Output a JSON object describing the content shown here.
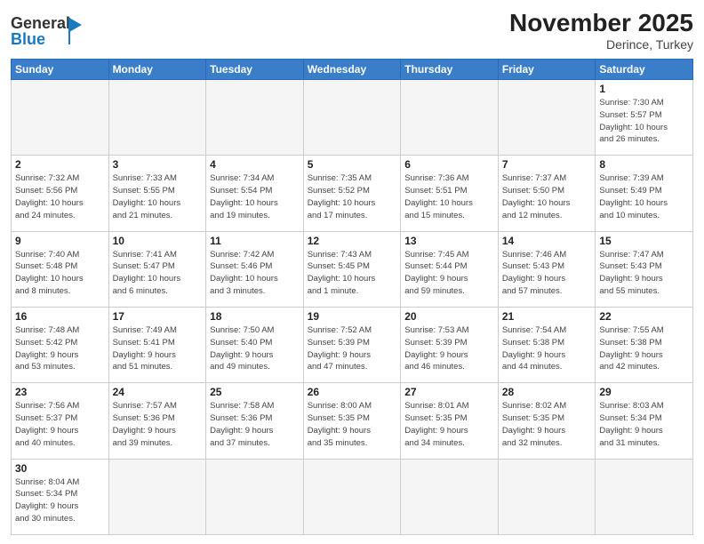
{
  "header": {
    "title": "November 2025",
    "subtitle": "Derince, Turkey",
    "logo_general": "General",
    "logo_blue": "Blue"
  },
  "weekdays": [
    "Sunday",
    "Monday",
    "Tuesday",
    "Wednesday",
    "Thursday",
    "Friday",
    "Saturday"
  ],
  "weeks": [
    [
      {
        "day": "",
        "info": ""
      },
      {
        "day": "",
        "info": ""
      },
      {
        "day": "",
        "info": ""
      },
      {
        "day": "",
        "info": ""
      },
      {
        "day": "",
        "info": ""
      },
      {
        "day": "",
        "info": ""
      },
      {
        "day": "1",
        "info": "Sunrise: 7:30 AM\nSunset: 5:57 PM\nDaylight: 10 hours\nand 26 minutes."
      }
    ],
    [
      {
        "day": "2",
        "info": "Sunrise: 7:32 AM\nSunset: 5:56 PM\nDaylight: 10 hours\nand 24 minutes."
      },
      {
        "day": "3",
        "info": "Sunrise: 7:33 AM\nSunset: 5:55 PM\nDaylight: 10 hours\nand 21 minutes."
      },
      {
        "day": "4",
        "info": "Sunrise: 7:34 AM\nSunset: 5:54 PM\nDaylight: 10 hours\nand 19 minutes."
      },
      {
        "day": "5",
        "info": "Sunrise: 7:35 AM\nSunset: 5:52 PM\nDaylight: 10 hours\nand 17 minutes."
      },
      {
        "day": "6",
        "info": "Sunrise: 7:36 AM\nSunset: 5:51 PM\nDaylight: 10 hours\nand 15 minutes."
      },
      {
        "day": "7",
        "info": "Sunrise: 7:37 AM\nSunset: 5:50 PM\nDaylight: 10 hours\nand 12 minutes."
      },
      {
        "day": "8",
        "info": "Sunrise: 7:39 AM\nSunset: 5:49 PM\nDaylight: 10 hours\nand 10 minutes."
      }
    ],
    [
      {
        "day": "9",
        "info": "Sunrise: 7:40 AM\nSunset: 5:48 PM\nDaylight: 10 hours\nand 8 minutes."
      },
      {
        "day": "10",
        "info": "Sunrise: 7:41 AM\nSunset: 5:47 PM\nDaylight: 10 hours\nand 6 minutes."
      },
      {
        "day": "11",
        "info": "Sunrise: 7:42 AM\nSunset: 5:46 PM\nDaylight: 10 hours\nand 3 minutes."
      },
      {
        "day": "12",
        "info": "Sunrise: 7:43 AM\nSunset: 5:45 PM\nDaylight: 10 hours\nand 1 minute."
      },
      {
        "day": "13",
        "info": "Sunrise: 7:45 AM\nSunset: 5:44 PM\nDaylight: 9 hours\nand 59 minutes."
      },
      {
        "day": "14",
        "info": "Sunrise: 7:46 AM\nSunset: 5:43 PM\nDaylight: 9 hours\nand 57 minutes."
      },
      {
        "day": "15",
        "info": "Sunrise: 7:47 AM\nSunset: 5:43 PM\nDaylight: 9 hours\nand 55 minutes."
      }
    ],
    [
      {
        "day": "16",
        "info": "Sunrise: 7:48 AM\nSunset: 5:42 PM\nDaylight: 9 hours\nand 53 minutes."
      },
      {
        "day": "17",
        "info": "Sunrise: 7:49 AM\nSunset: 5:41 PM\nDaylight: 9 hours\nand 51 minutes."
      },
      {
        "day": "18",
        "info": "Sunrise: 7:50 AM\nSunset: 5:40 PM\nDaylight: 9 hours\nand 49 minutes."
      },
      {
        "day": "19",
        "info": "Sunrise: 7:52 AM\nSunset: 5:39 PM\nDaylight: 9 hours\nand 47 minutes."
      },
      {
        "day": "20",
        "info": "Sunrise: 7:53 AM\nSunset: 5:39 PM\nDaylight: 9 hours\nand 46 minutes."
      },
      {
        "day": "21",
        "info": "Sunrise: 7:54 AM\nSunset: 5:38 PM\nDaylight: 9 hours\nand 44 minutes."
      },
      {
        "day": "22",
        "info": "Sunrise: 7:55 AM\nSunset: 5:38 PM\nDaylight: 9 hours\nand 42 minutes."
      }
    ],
    [
      {
        "day": "23",
        "info": "Sunrise: 7:56 AM\nSunset: 5:37 PM\nDaylight: 9 hours\nand 40 minutes."
      },
      {
        "day": "24",
        "info": "Sunrise: 7:57 AM\nSunset: 5:36 PM\nDaylight: 9 hours\nand 39 minutes."
      },
      {
        "day": "25",
        "info": "Sunrise: 7:58 AM\nSunset: 5:36 PM\nDaylight: 9 hours\nand 37 minutes."
      },
      {
        "day": "26",
        "info": "Sunrise: 8:00 AM\nSunset: 5:35 PM\nDaylight: 9 hours\nand 35 minutes."
      },
      {
        "day": "27",
        "info": "Sunrise: 8:01 AM\nSunset: 5:35 PM\nDaylight: 9 hours\nand 34 minutes."
      },
      {
        "day": "28",
        "info": "Sunrise: 8:02 AM\nSunset: 5:35 PM\nDaylight: 9 hours\nand 32 minutes."
      },
      {
        "day": "29",
        "info": "Sunrise: 8:03 AM\nSunset: 5:34 PM\nDaylight: 9 hours\nand 31 minutes."
      }
    ],
    [
      {
        "day": "30",
        "info": "Sunrise: 8:04 AM\nSunset: 5:34 PM\nDaylight: 9 hours\nand 30 minutes."
      },
      {
        "day": "",
        "info": ""
      },
      {
        "day": "",
        "info": ""
      },
      {
        "day": "",
        "info": ""
      },
      {
        "day": "",
        "info": ""
      },
      {
        "day": "",
        "info": ""
      },
      {
        "day": "",
        "info": ""
      }
    ]
  ]
}
